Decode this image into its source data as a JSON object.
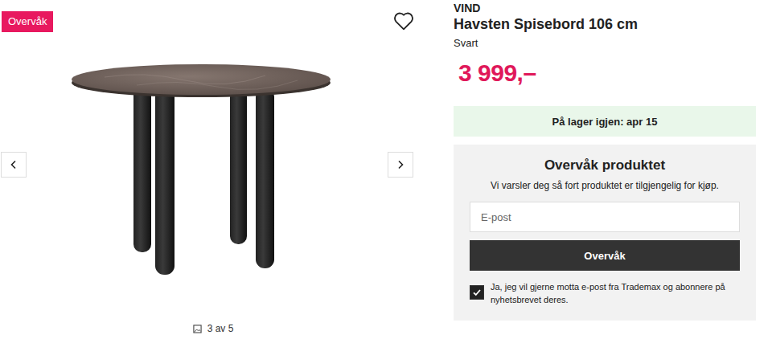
{
  "badge": "Overvåk",
  "gallery": {
    "counter": "3 av 5",
    "favorite": false
  },
  "product": {
    "brand": "VIND",
    "title": "Havsten Spisebord 106 cm",
    "color": "Svart",
    "price": "3 999,–"
  },
  "stock": {
    "label": "På lager igjen: apr 15"
  },
  "watch": {
    "title": "Overvåk produktet",
    "description": "Vi varsler deg så fort produktet er tilgjengelig for kjøp.",
    "email": {
      "placeholder": "E-post",
      "value": ""
    },
    "button": "Overvåk",
    "newsletter": {
      "checked": true,
      "label": "Ja, jeg vil gjerne motta e-post fra Trademax og abonnere på nyhetsbrevet deres."
    }
  }
}
